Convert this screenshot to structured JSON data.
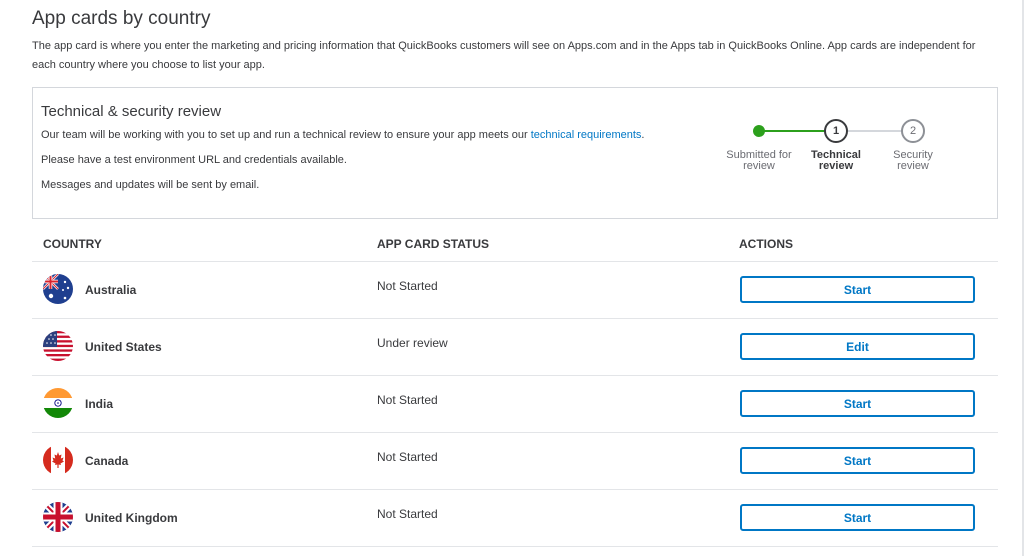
{
  "page": {
    "title": "App cards by country",
    "intro": "The app card is where you enter the marketing and pricing information that QuickBooks customers will see on Apps.com and in the Apps tab in QuickBooks Online. App cards are independent for each country where you choose to list your app."
  },
  "review": {
    "title": "Technical & security review",
    "line1_before": "Our team will be working with you to set up and run a technical review to ensure your app meets our ",
    "line1_link": "technical requirements",
    "line1_after": ".",
    "line2": "Please have a test environment URL and credentials available.",
    "line3": "Messages and updates will be sent by email.",
    "steps": [
      {
        "number": "",
        "label_line1": "Submitted for",
        "label_line2": "review",
        "state": "complete"
      },
      {
        "number": "1",
        "label_line1": "Technical",
        "label_line2": "review",
        "state": "active"
      },
      {
        "number": "2",
        "label_line1": "Security",
        "label_line2": "review",
        "state": "pending"
      }
    ],
    "colors": {
      "complete": "#2ca01c",
      "active": "#393a3d",
      "pending": "#8d9096"
    }
  },
  "table": {
    "headers": {
      "country": "COUNTRY",
      "status": "APP CARD STATUS",
      "actions": "ACTIONS"
    },
    "rows": [
      {
        "country": "Australia",
        "flag_icon": "australia-flag-icon",
        "status": "Not Started",
        "action": "Start"
      },
      {
        "country": "United States",
        "flag_icon": "united-states-flag-icon",
        "status": "Under review",
        "action": "Edit"
      },
      {
        "country": "India",
        "flag_icon": "india-flag-icon",
        "status": "Not Started",
        "action": "Start"
      },
      {
        "country": "Canada",
        "flag_icon": "canada-flag-icon",
        "status": "Not Started",
        "action": "Start"
      },
      {
        "country": "United Kingdom",
        "flag_icon": "united-kingdom-flag-icon",
        "status": "Not Started",
        "action": "Start"
      }
    ]
  },
  "colors": {
    "link": "#0077c5",
    "border": "#d4d7dc",
    "text": "#393a3d"
  }
}
